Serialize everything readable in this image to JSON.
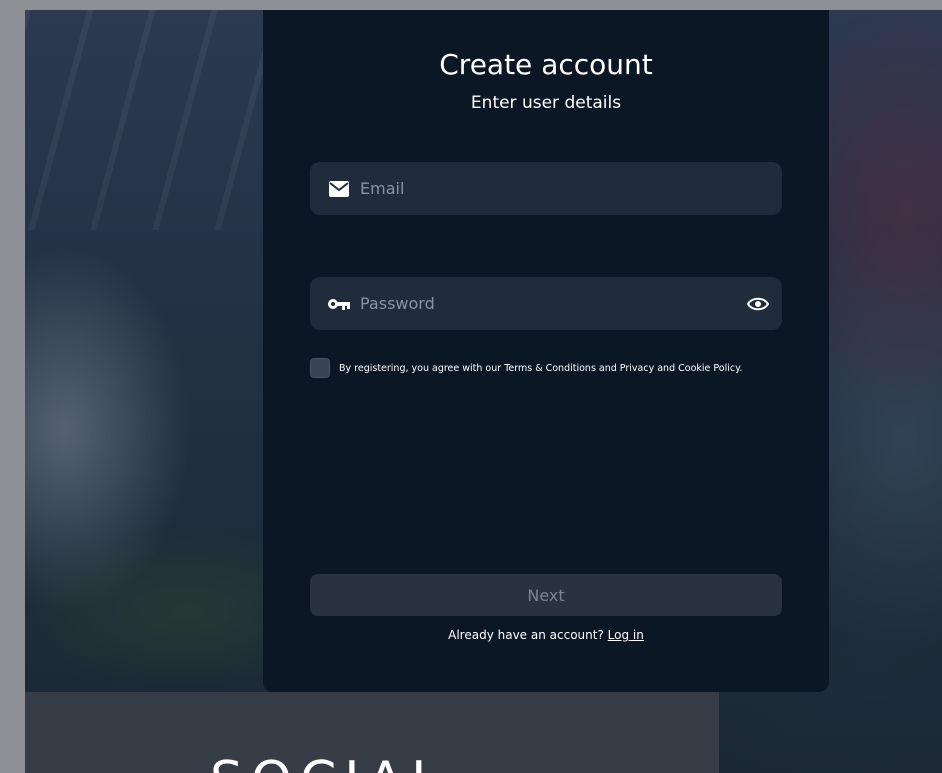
{
  "header": {
    "title": "Create account",
    "subtitle": "Enter user details"
  },
  "form": {
    "email_placeholder": "Email",
    "password_placeholder": "Password",
    "agree_text": "By registering, you agree with our Terms & Conditions and Privacy and Cookie Policy.",
    "agree_checked": false,
    "next_label": "Next"
  },
  "footer": {
    "prompt": "Already have an account?",
    "login_label": "Log in"
  },
  "brand": {
    "text": "SOCIAL"
  },
  "icons": {
    "email": "mail-icon",
    "password": "key-icon",
    "toggle": "eye-icon"
  },
  "colors": {
    "card_bg": "#0c1726",
    "field_bg": "#202b3b",
    "button_bg": "#283240",
    "button_text": "#7b8493",
    "page_bg": "#8e9096"
  }
}
